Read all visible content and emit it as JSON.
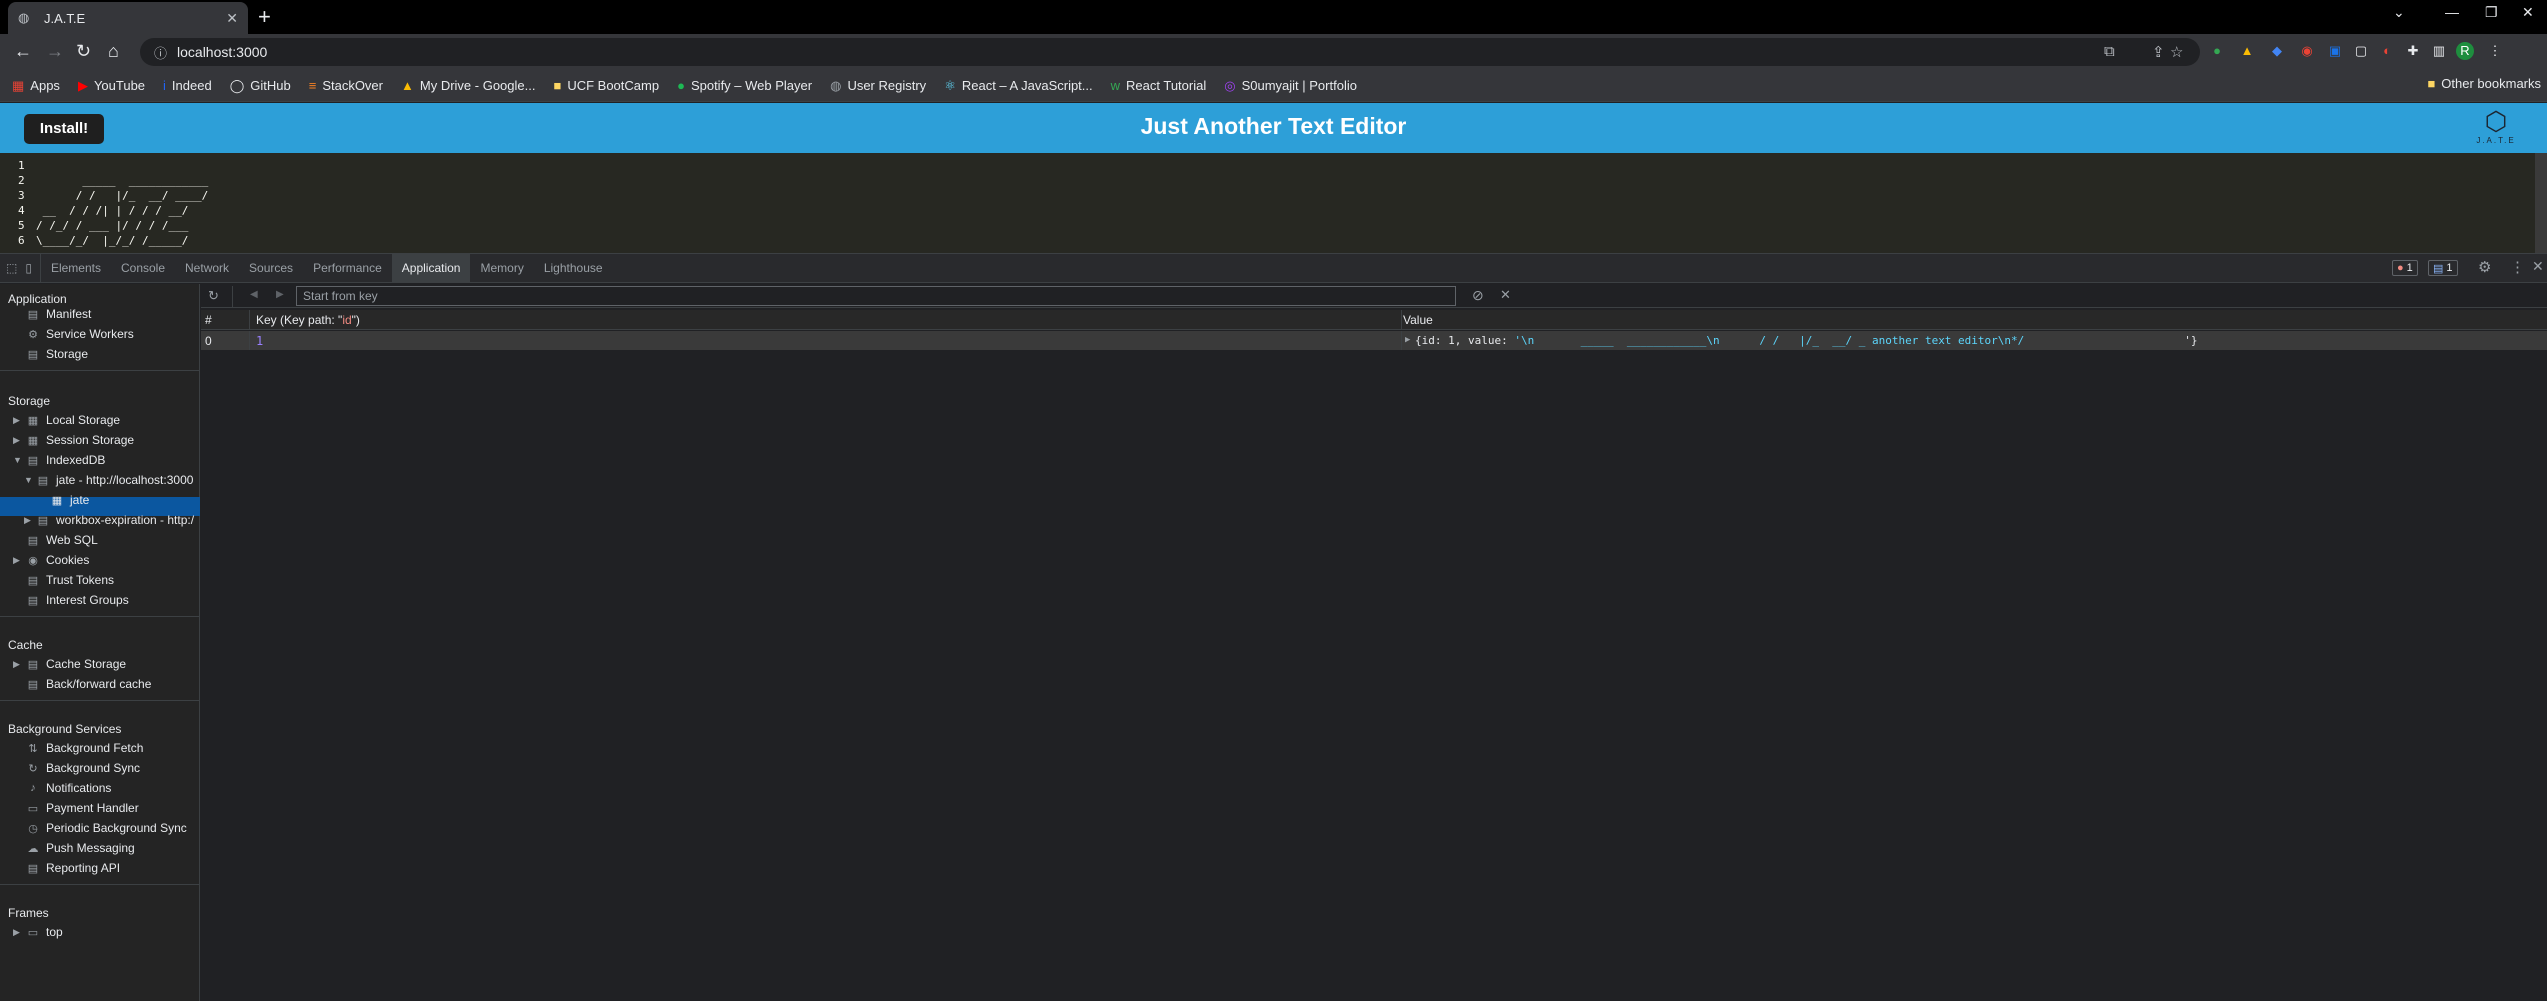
{
  "browser": {
    "tab_title": "J.A.T.E",
    "url": "localhost:3000",
    "bookmarks": [
      "Apps",
      "YouTube",
      "Indeed",
      "GitHub",
      "StackOver",
      "My Drive - Google...",
      "UCF BootCamp",
      "Spotify – Web Player",
      "User Registry",
      "React – A JavaScript...",
      "React Tutorial",
      "S0umyajit | Portfolio"
    ],
    "other_bookmarks": "Other bookmarks",
    "profile_initial": "R"
  },
  "app": {
    "install_label": "Install!",
    "title": "Just Another Text Editor",
    "logo_text": "J.A.T.E",
    "editor_line_numbers": [
      "1",
      "2",
      "3",
      "4",
      "5",
      "6"
    ],
    "editor_lines": [
      "",
      "       _____  ____________",
      "      / /   |/_  __/ ____/",
      " __  / / /| | / / / __/",
      "/ /_/ / ___ |/ / / /___",
      "\\____/_/  |_/_/ /_____/"
    ]
  },
  "devtools": {
    "tabs": [
      "Elements",
      "Console",
      "Network",
      "Sources",
      "Performance",
      "Application",
      "Memory",
      "Lighthouse"
    ],
    "active_tab": "Application",
    "errors": "1",
    "messages": "1",
    "sidebar": {
      "application_header": "Application",
      "application_items": [
        "Manifest",
        "Service Workers",
        "Storage"
      ],
      "storage_header": "Storage",
      "storage_items": [
        "Local Storage",
        "Session Storage",
        "IndexedDB",
        "jate - http://localhost:3000",
        "jate",
        "workbox-expiration - http:/",
        "Web SQL",
        "Cookies",
        "Trust Tokens",
        "Interest Groups"
      ],
      "cache_header": "Cache",
      "cache_items": [
        "Cache Storage",
        "Back/forward cache"
      ],
      "bg_header": "Background Services",
      "bg_items": [
        "Background Fetch",
        "Background Sync",
        "Notifications",
        "Payment Handler",
        "Periodic Background Sync",
        "Push Messaging",
        "Reporting API"
      ],
      "frames_header": "Frames",
      "frames_items": [
        "top"
      ]
    },
    "key_placeholder": "Start from key",
    "table": {
      "col_index": "#",
      "col_key_prefix": "Key (Key path: \"",
      "col_key_path": "id",
      "col_key_suffix": "\")",
      "col_value": "Value",
      "row_index": "0",
      "row_key": "1",
      "row_value_prefix": "{id: 1, value: ",
      "row_value_string": "'\\n       _____  ____________\\n      / /   |/_  __/ _ another text editor\\n*/",
      "row_value_suffix": "'}"
    }
  }
}
